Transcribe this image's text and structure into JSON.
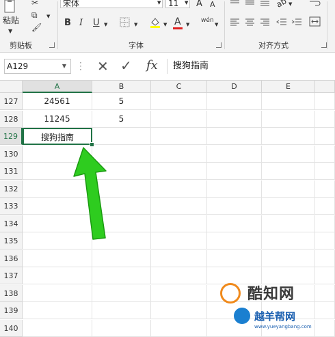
{
  "ribbon": {
    "clipboard": {
      "paste_label": "粘贴",
      "group_label": "剪贴板"
    },
    "font": {
      "font_name": "宋体",
      "font_size": "11",
      "grow_font": "A",
      "shrink_font": "A",
      "bold": "B",
      "italic": "I",
      "underline": "U",
      "font_color_glyph": "A",
      "phonetic_glyph": "wén",
      "group_label": "字体"
    },
    "alignment": {
      "group_label": "对齐方式"
    }
  },
  "formula_bar": {
    "name_box": "A129",
    "cancel_glyph": "✕",
    "enter_glyph": "✓",
    "fx_glyph": "fx",
    "content": "搜狗指南"
  },
  "grid": {
    "columns": [
      "A",
      "B",
      "C",
      "D",
      "E"
    ],
    "rows": [
      {
        "num": "127",
        "A": "24561",
        "B": "5"
      },
      {
        "num": "128",
        "A": "11245",
        "B": "5"
      },
      {
        "num": "129",
        "A": "搜狗指南",
        "B": ""
      },
      {
        "num": "130"
      },
      {
        "num": "131"
      },
      {
        "num": "132"
      },
      {
        "num": "133"
      },
      {
        "num": "134"
      },
      {
        "num": "135"
      },
      {
        "num": "136"
      },
      {
        "num": "137"
      },
      {
        "num": "138"
      },
      {
        "num": "139"
      },
      {
        "num": "140"
      }
    ],
    "active_cell": "A129"
  },
  "watermark": {
    "brand_text": "酷知网",
    "brand2_text": "越羊帮网",
    "url_text": "www.yueyangbang.com"
  },
  "colors": {
    "excel_green": "#217346",
    "arrow_green": "#2ecc1f",
    "font_color_red": "#e02020"
  }
}
